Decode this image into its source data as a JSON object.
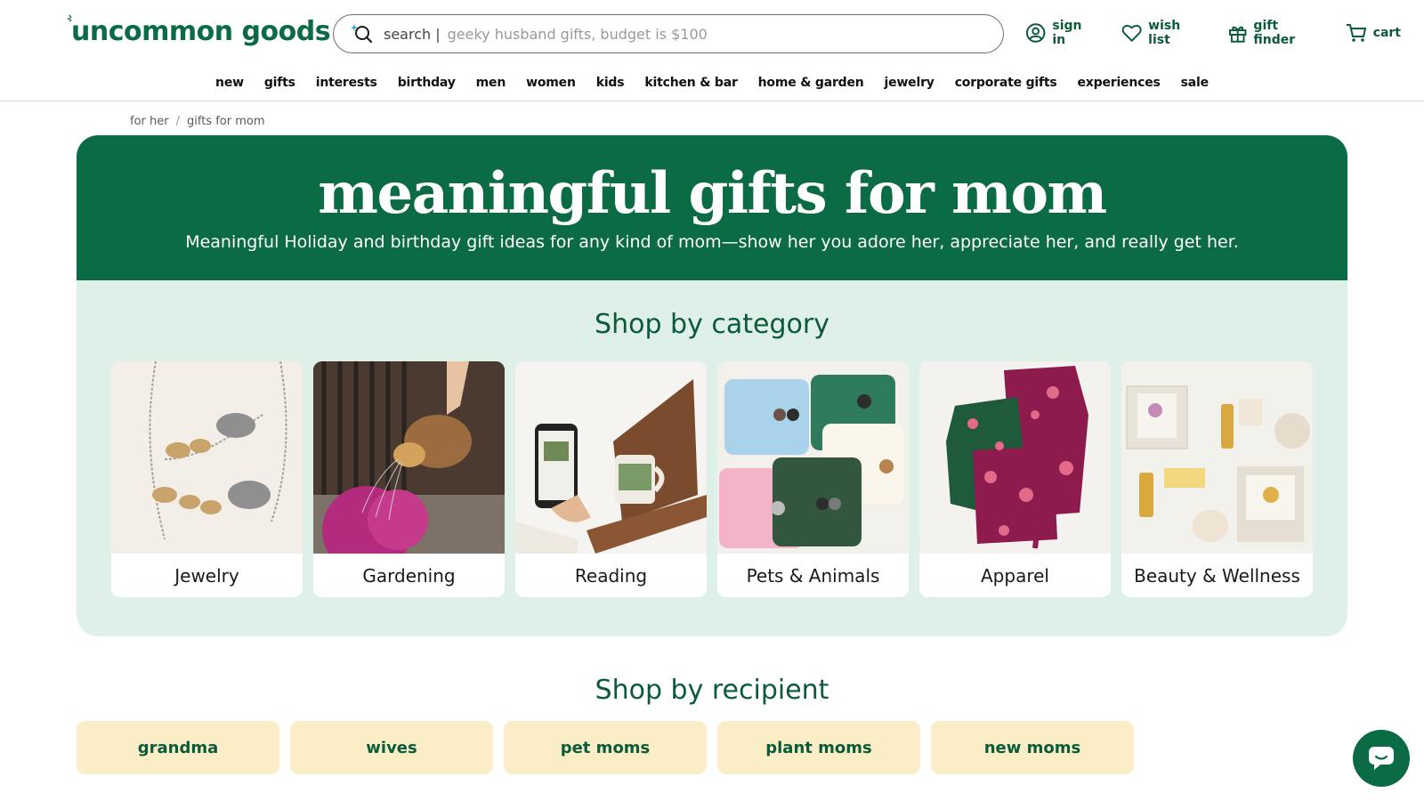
{
  "header": {
    "logo": "uncommon goods",
    "search_label": "search |",
    "search_placeholder": "geeky husband gifts, budget is $100",
    "sign_in": "sign in",
    "wish_list": "wish list",
    "gift_finder": "gift finder",
    "cart": "cart"
  },
  "nav": [
    "new",
    "gifts",
    "interests",
    "birthday",
    "men",
    "women",
    "kids",
    "kitchen & bar",
    "home & garden",
    "jewelry",
    "corporate gifts",
    "experiences",
    "sale"
  ],
  "breadcrumb": [
    "for her",
    "gifts for mom"
  ],
  "hero": {
    "title": "meaningful gifts for mom",
    "subtitle": "Meaningful Holiday and birthday gift ideas for any kind of mom—show her you adore her, appreciate her, and really get her."
  },
  "category_section": {
    "title": "Shop by category",
    "cards": [
      "Jewelry",
      "Gardening",
      "Reading",
      "Pets & Animals",
      "Apparel",
      "Beauty & Wellness"
    ]
  },
  "recipient_section": {
    "title": "Shop by recipient",
    "items": [
      "grandma",
      "wives",
      "pet moms",
      "plant moms",
      "new moms"
    ]
  },
  "colors": {
    "brand_green": "#0b6b44",
    "mint_panel": "#dff0e9",
    "recipient_bg": "#fbeec7"
  },
  "icons": [
    "search-icon",
    "user-icon",
    "heart-icon",
    "gift-icon",
    "cart-icon",
    "chat-icon"
  ]
}
